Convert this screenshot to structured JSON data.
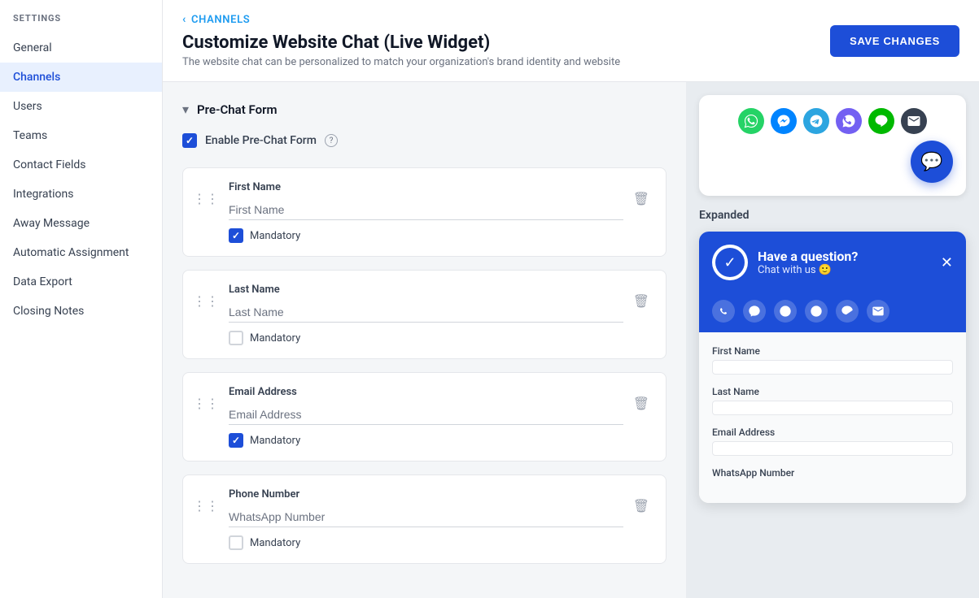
{
  "sidebar": {
    "title": "SETTINGS",
    "items": [
      {
        "label": "General",
        "active": false
      },
      {
        "label": "Channels",
        "active": true
      },
      {
        "label": "Users",
        "active": false
      },
      {
        "label": "Teams",
        "active": false
      },
      {
        "label": "Contact Fields",
        "active": false
      },
      {
        "label": "Integrations",
        "active": false
      },
      {
        "label": "Away Message",
        "active": false
      },
      {
        "label": "Automatic Assignment",
        "active": false
      },
      {
        "label": "Data Export",
        "active": false
      },
      {
        "label": "Closing Notes",
        "active": false
      }
    ]
  },
  "header": {
    "breadcrumb": "CHANNELS",
    "title": "Customize Website Chat (Live Widget)",
    "subtitle": "The website chat can be personalized to match your organization's brand identity and website",
    "save_button": "SAVE CHANGES"
  },
  "section": {
    "title": "Pre-Chat Form",
    "enable_label": "Enable Pre-Chat Form"
  },
  "fields": [
    {
      "name": "First Name",
      "placeholder": "First Name",
      "mandatory": true
    },
    {
      "name": "Last Name",
      "placeholder": "Last Name",
      "mandatory": false
    },
    {
      "name": "Email Address",
      "placeholder": "Email Address",
      "mandatory": true
    },
    {
      "name": "Phone Number",
      "placeholder": "WhatsApp Number",
      "mandatory": false
    }
  ],
  "preview": {
    "expanded_label": "Expanded",
    "widget_title": "Have a question?",
    "widget_subtitle": "Chat with us 🙂",
    "form_fields": [
      {
        "label": "First Name"
      },
      {
        "label": "Last Name"
      },
      {
        "label": "Email Address"
      },
      {
        "label": "WhatsApp Number"
      }
    ]
  }
}
